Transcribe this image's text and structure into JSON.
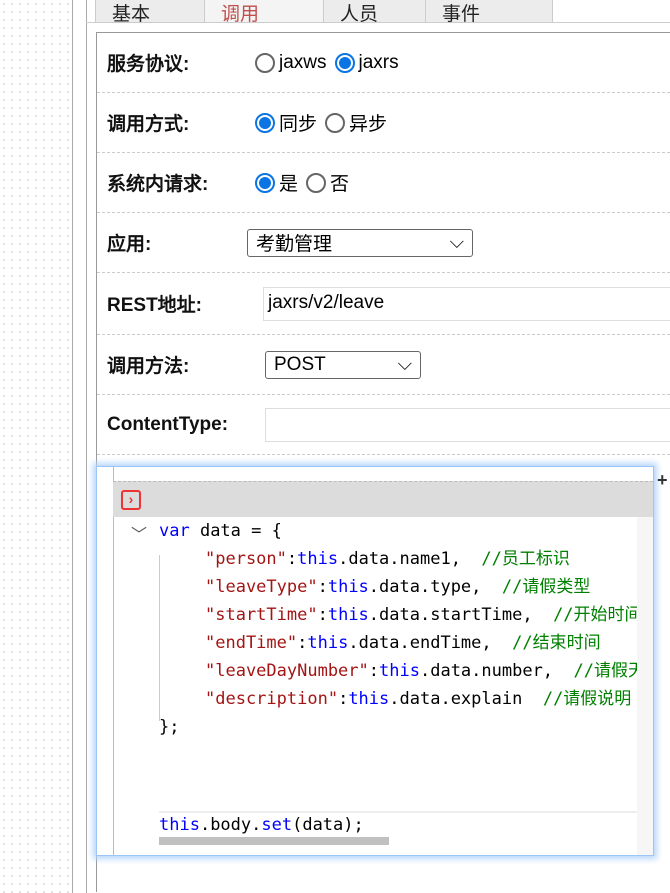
{
  "tabs": [
    "基本",
    "调用",
    "人员",
    "事件"
  ],
  "active_tab": 1,
  "form": {
    "protocol": {
      "label": "服务协议:",
      "options": [
        "jaxws",
        "jaxrs"
      ]
    },
    "call_mode": {
      "label": "调用方式:",
      "options": [
        "同步",
        "异步"
      ]
    },
    "internal": {
      "label": "系统内请求:",
      "options": [
        "是",
        "否"
      ]
    },
    "app": {
      "label": "应用:",
      "value": "考勤管理"
    },
    "rest": {
      "label": "REST地址:",
      "value": "jaxrs/v2/leave"
    },
    "method": {
      "label": "调用方法:",
      "value": "POST"
    },
    "content_type": {
      "label": "ContentType:",
      "value": ""
    }
  },
  "code": {
    "l1": [
      "var",
      " data = {"
    ],
    "props": [
      {
        "key": "\"person\"",
        "val": "data.name1,",
        "cm": "//员工标识"
      },
      {
        "key": "\"leaveType\"",
        "val": "data.type,",
        "cm": "//请假类型"
      },
      {
        "key": "\"startTime\"",
        "val": "data.startTime,",
        "cm": "//开始时间"
      },
      {
        "key": "\"endTime\"",
        "val": "data.endTime,",
        "cm": "//结束时间"
      },
      {
        "key": "\"leaveDayNumber\"",
        "val": "data.number,",
        "cm": "//请假天数"
      },
      {
        "key": "\"description\"",
        "val": "data.explain",
        "cm": "//请假说明"
      }
    ],
    "this": "this",
    "close": "};",
    "last": [
      "this",
      ".body.",
      "set",
      "(data);"
    ]
  }
}
